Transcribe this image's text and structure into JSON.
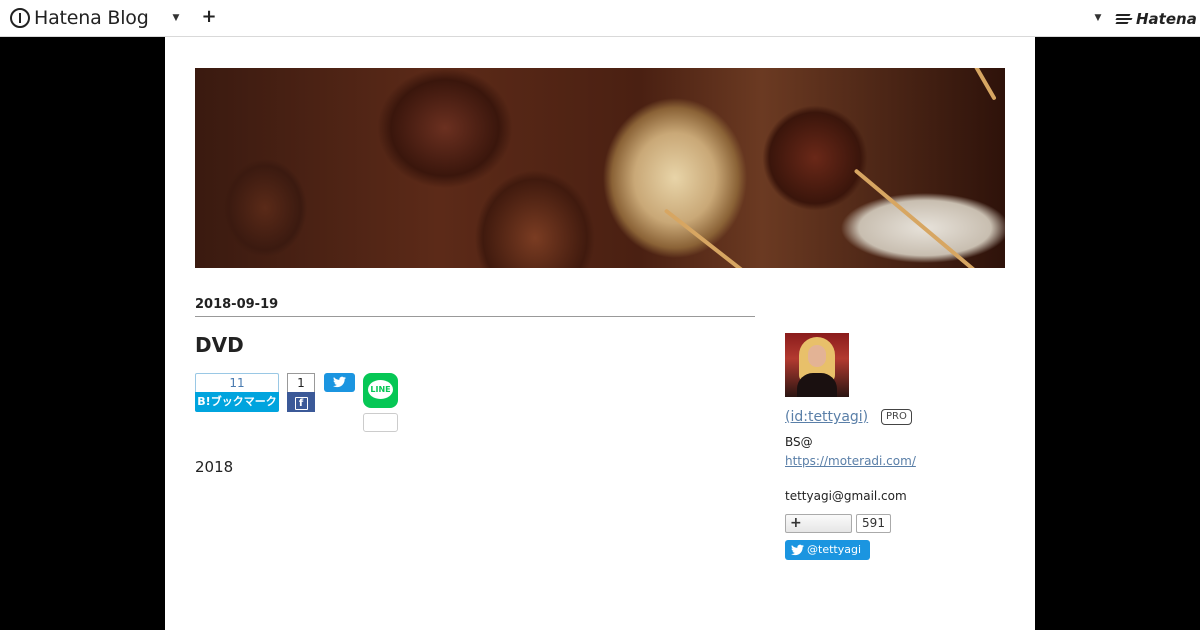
{
  "global_header": {
    "logo_text": "Hatena Blog",
    "hatena_text": "Hatena"
  },
  "entry": {
    "date": "2018-09-19",
    "title": "DVD",
    "hatena_bookmark": {
      "count": "11",
      "label": "B!ブックマーク"
    },
    "facebook": {
      "count": "1"
    },
    "line": {
      "label": "LINE"
    },
    "body": "2018"
  },
  "sidebar": {
    "profile_id": " (id:tettyagi)",
    "pro_badge": "PRO",
    "description": "BS@",
    "link": "https://moteradi.com/",
    "email": "tettyagi@gmail.com",
    "follow_count": "591",
    "twitter_handle": "@tettyagi"
  },
  "colors": {
    "hatena_bookmark_blue": "#00a4de",
    "facebook_blue": "#3b5998",
    "twitter_blue": "#1b95e0",
    "line_green": "#06c755",
    "link_blue": "#5a7fa8"
  }
}
